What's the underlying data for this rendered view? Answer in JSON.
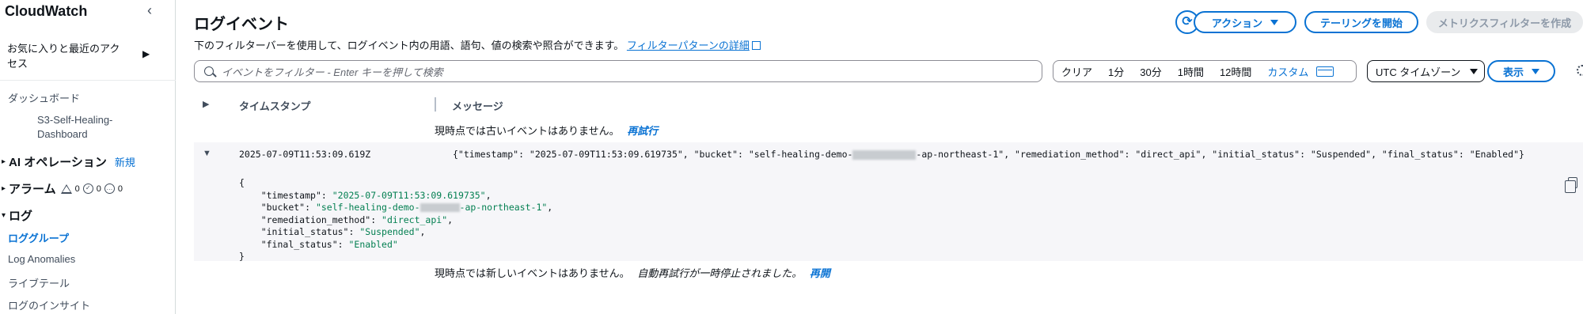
{
  "sidebar": {
    "title": "CloudWatch",
    "favorites": "お気に入りと最近のアクセス",
    "dashboards": "ダッシュボード",
    "dashboard_item": "S3-Self-Healing-Dashboard",
    "ai_ops": "AI オペレーション",
    "ai_ops_badge": "新規",
    "alarms": "アラーム",
    "alarm_counts": {
      "alarm": "0",
      "ok": "0",
      "insufficient": "0"
    },
    "logs": "ログ",
    "log_groups": "ロググループ",
    "log_anomalies": "Log Anomalies",
    "live_tail": "ライブテール",
    "log_insights": "ログのインサイト"
  },
  "header": {
    "title": "ログイベント",
    "description": "下のフィルターバーを使用して、ログイベント内の用語、語句、値の検索や照合ができます。",
    "description_link": "フィルターパターンの詳細",
    "actions_button": "アクション",
    "tail_button": "テーリングを開始",
    "metric_filter_button": "メトリクスフィルターを作成"
  },
  "filter": {
    "placeholder": "イベントをフィルター - Enter キーを押して検索",
    "ranges": [
      "クリア",
      "1分",
      "30分",
      "1時間",
      "12時間"
    ],
    "custom": "カスタム",
    "timezone": "UTC タイムゾーン",
    "display_button": "表示"
  },
  "table": {
    "col_timestamp": "タイムスタンプ",
    "col_message": "メッセージ",
    "no_older": "現時点では古いイベントはありません。",
    "retry": "再試行",
    "no_newer": "現時点では新しいイベントはありません。",
    "auto_retry_paused": "自動再試行が一時停止されました。",
    "resume": "再開"
  },
  "event": {
    "timestamp": "2025-07-09T11:53:09.619Z",
    "message_prefix": "{\"timestamp\": \"2025-07-09T11:53:09.619735\", \"bucket\": \"self-healing-demo-",
    "message_suffix": "-ap-northeast-1\", \"remediation_method\": \"direct_api\", \"initial_status\": \"Suspended\", \"final_status\": \"Enabled\"}",
    "json": {
      "open": "{",
      "timestamp_key": "\"timestamp\"",
      "timestamp_val": "\"2025-07-09T11:53:09.619735\"",
      "bucket_key": "\"bucket\"",
      "bucket_val_prefix": "\"self-healing-demo-",
      "bucket_val_suffix": "-ap-northeast-1\"",
      "method_key": "\"remediation_method\"",
      "method_val": "\"direct_api\"",
      "initial_key": "\"initial_status\"",
      "initial_val": "\"Suspended\"",
      "final_key": "\"final_status\"",
      "final_val": "\"Enabled\"",
      "close": "}"
    }
  },
  "colors": {
    "accent": "#0972d3",
    "json_string": "#037f51",
    "row_bg": "#f6f6f9"
  }
}
